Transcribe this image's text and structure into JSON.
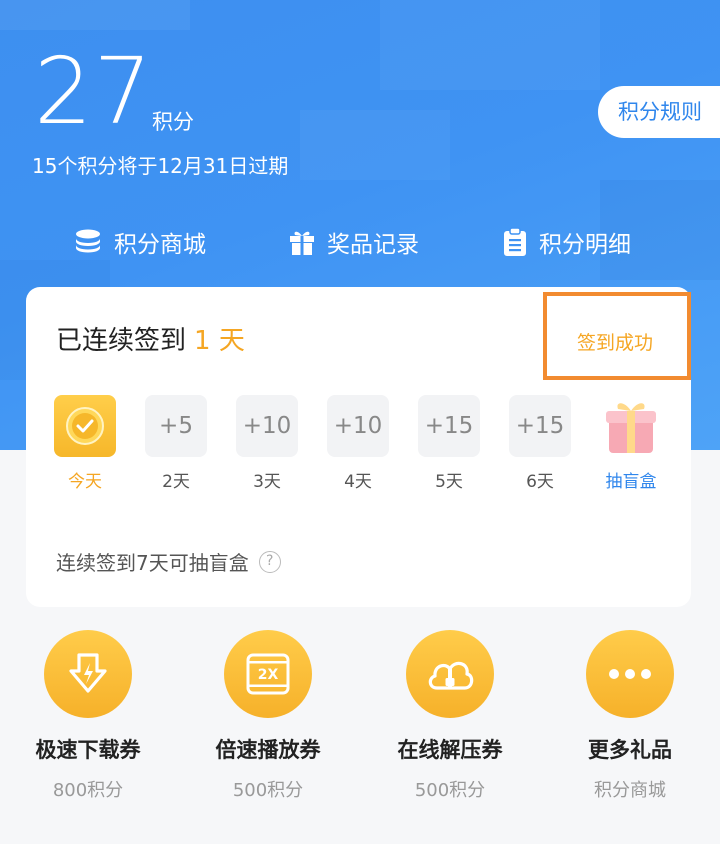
{
  "header": {
    "points_value": "27",
    "points_unit": "积分",
    "expire_note": "15个积分将于12月31日过期",
    "rules_label": "积分规则"
  },
  "nav": [
    {
      "label": "积分商城",
      "icon": "coins-stack-icon"
    },
    {
      "label": "奖品记录",
      "icon": "gift-icon"
    },
    {
      "label": "积分明细",
      "icon": "clipboard-icon"
    }
  ],
  "checkin": {
    "streak_prefix": "已连续签到",
    "streak_days": "1 天",
    "status": "签到成功",
    "days": [
      {
        "value": "",
        "label": "今天",
        "state": "checked"
      },
      {
        "value": "+5",
        "label": "2天"
      },
      {
        "value": "+10",
        "label": "3天"
      },
      {
        "value": "+10",
        "label": "4天"
      },
      {
        "value": "+15",
        "label": "5天"
      },
      {
        "value": "+15",
        "label": "6天"
      },
      {
        "value": "",
        "label": "抽盲盒",
        "icon": "gift-box-icon"
      }
    ],
    "tip": "连续签到7天可抽盲盒",
    "tip_icon": "?"
  },
  "rewards": [
    {
      "title": "极速下载券",
      "cost": "800积分",
      "icon": "download-icon"
    },
    {
      "title": "倍速播放券",
      "cost": "500积分",
      "icon": "speed-2x-icon",
      "icon_text": "2X"
    },
    {
      "title": "在线解压券",
      "cost": "500积分",
      "icon": "cloud-zip-icon"
    },
    {
      "title": "更多礼品",
      "cost": "积分商城",
      "icon": "more-dots-icon"
    }
  ],
  "colors": {
    "primary_blue": "#3d8ff0",
    "accent_orange": "#f5a623",
    "highlight_border": "#f28b30"
  }
}
